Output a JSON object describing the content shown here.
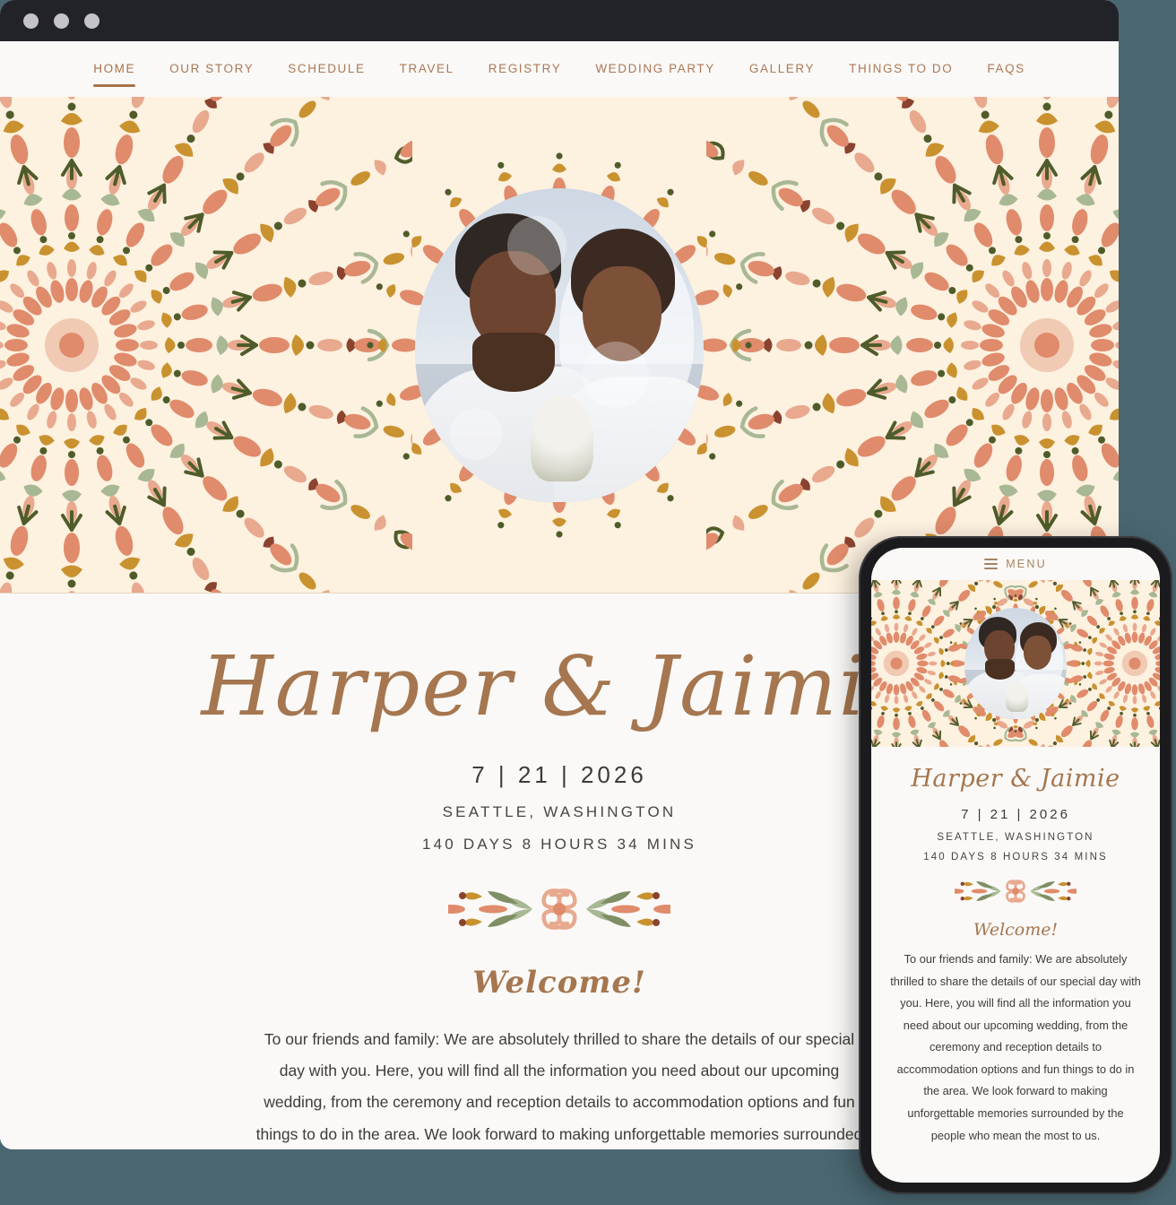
{
  "window": {
    "traffic_lights": [
      "close-dot",
      "minimize-dot",
      "maximize-dot"
    ]
  },
  "nav": {
    "items": [
      {
        "label": "HOME",
        "active": true
      },
      {
        "label": "OUR STORY",
        "active": false
      },
      {
        "label": "SCHEDULE",
        "active": false
      },
      {
        "label": "TRAVEL",
        "active": false
      },
      {
        "label": "REGISTRY",
        "active": false
      },
      {
        "label": "WEDDING PARTY",
        "active": false
      },
      {
        "label": "GALLERY",
        "active": false
      },
      {
        "label": "THINGS TO DO",
        "active": false
      },
      {
        "label": "FAQS",
        "active": false
      }
    ]
  },
  "hero": {
    "photo_alt": "Smiling couple in white wedding attire on a beach",
    "background_color": "#fdf1e0",
    "ornament": "boho-floral-mandala"
  },
  "main": {
    "couple_names": "Harper & Jaimie",
    "wedding_date": "7 | 21 | 2026",
    "location": "SEATTLE, WASHINGTON",
    "countdown": "140 DAYS   8 HOURS  34 MINS",
    "divider": "floral-divider-ornament",
    "welcome_heading": "Welcome!",
    "welcome_body": "To our friends and family: We are absolutely thrilled to share the details of our special day with you. Here, you will find all the information you need about our upcoming wedding, from the ceremony and reception details to accommodation options and fun things to do in the area. We look forward to making unforgettable memories surrounded by the people who mean the most to us."
  },
  "phone": {
    "menu_label": "MENU",
    "menu_icon": "hamburger-icon",
    "couple_names": "Harper & Jaimie",
    "wedding_date": "7 | 21 | 2026",
    "location": "SEATTLE, WASHINGTON",
    "countdown": "140 DAYS   8 HOURS  34 MINS",
    "welcome_heading": "Welcome!",
    "welcome_body": "To our friends and family: We are absolutely thrilled to share the details of our special day with you. Here, you will find all the information you need about our upcoming wedding, from the ceremony and reception details to accommodation options and fun things to do in the area. We look forward to making unforgettable memories surrounded by the people who mean the most to us."
  },
  "colors": {
    "page_background": "#4a6771",
    "titlebar": "#212329",
    "hero_cream": "#fdf1e0",
    "content_bg": "#faf9f7",
    "accent_brown": "#a9714b",
    "script_brown": "#a5764f",
    "coral": "#e08b6b",
    "salmon": "#e8a98e",
    "olive": "#4f5c2a",
    "sage": "#a8b894",
    "gold": "#c9922f",
    "maroon": "#8a432f"
  }
}
